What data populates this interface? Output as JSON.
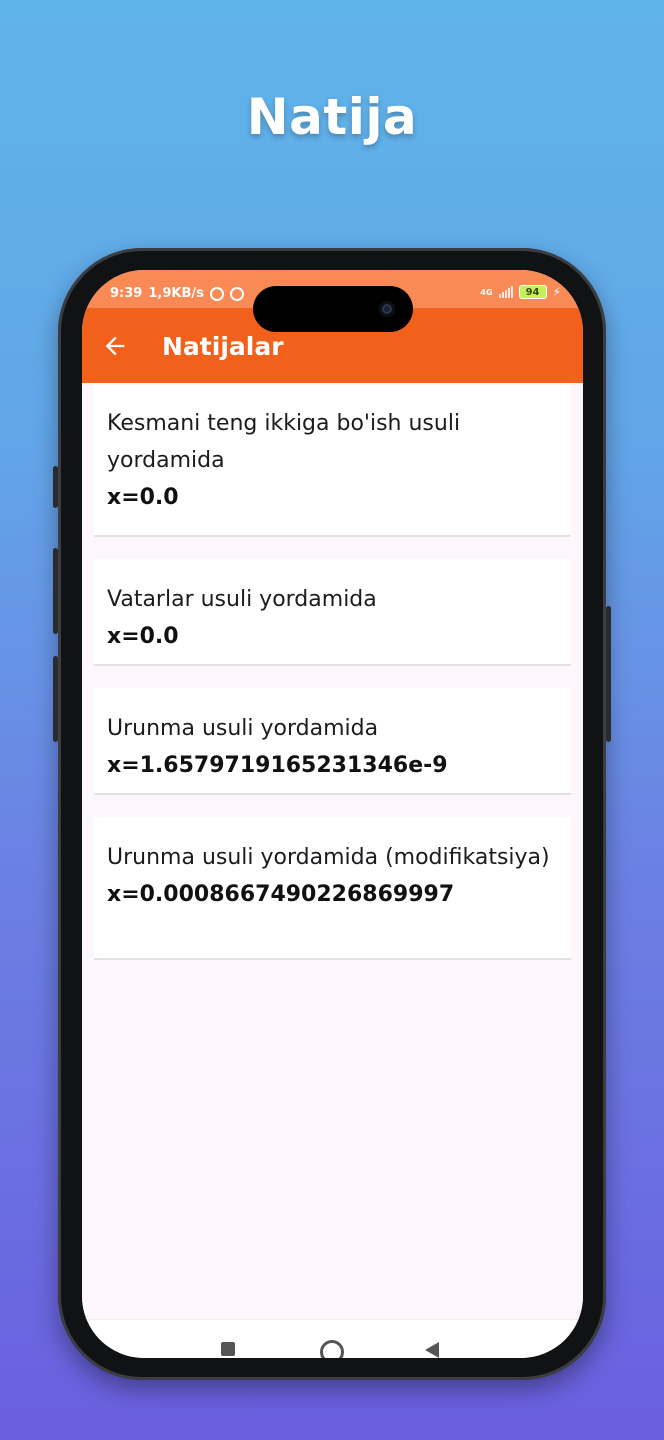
{
  "promo": {
    "title": "Natija"
  },
  "status_bar": {
    "time": "9:39",
    "speed": "1,9KB/s",
    "network": "4G",
    "battery": "94"
  },
  "app_bar": {
    "title": "Natijalar",
    "back_icon": "arrow-left-icon"
  },
  "results": [
    {
      "label": "Kesmani teng ikkiga bo'ish usuli yordamida",
      "value": "x=0.0"
    },
    {
      "label": "Vatarlar usuli yordamida",
      "value": "x=0.0"
    },
    {
      "label": "Urunma usuli yordamida",
      "value": "x=1.6579719165231346e-9"
    },
    {
      "label": "Urunma usuli yordamida (modifikatsiya)",
      "value": "x=0.0008667490226869997"
    }
  ],
  "colors": {
    "app_bar": "#f2611c",
    "status_bar": "#f98a55",
    "background_top": "#5fb4ea",
    "background_bottom": "#6a5fdf"
  }
}
